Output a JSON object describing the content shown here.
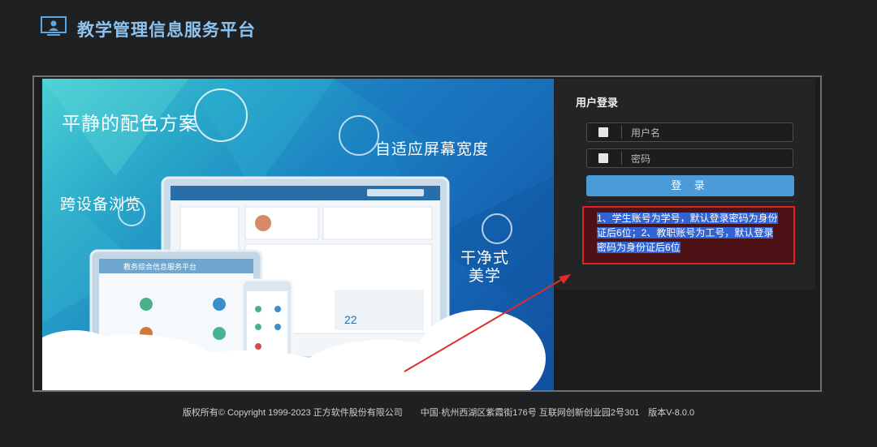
{
  "header": {
    "title": "教学管理信息服务平台",
    "logo_icon": "monitor-user-icon"
  },
  "banner": {
    "slogans": [
      "平静的配色方案",
      "自适应屏幕宽度",
      "跨设备浏览",
      "干净式",
      "美学"
    ],
    "mock_app_title": "教务综合信息服务平台"
  },
  "login": {
    "title": "用户登录",
    "username_placeholder": "用户名",
    "password_placeholder": "密码",
    "submit_label": "登 录",
    "notice": "1、学生账号为学号，默认登录密码为身份证后6位；2、教职账号为工号，默认登录密码为身份证后6位"
  },
  "footer": {
    "text": "版权所有© Copyright 1999-2023 正方软件股份有限公司　　中国·杭州西湖区紫霞街176号 互联网创新创业园2号301　版本V-8.0.0"
  },
  "colors": {
    "accent": "#4a9bd8",
    "highlight_border": "#dd2222",
    "title": "#8fc3ef"
  }
}
